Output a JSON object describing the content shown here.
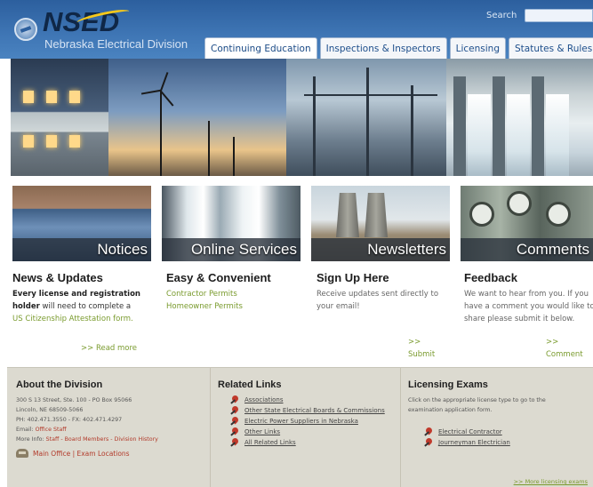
{
  "header": {
    "logo_text": "NSED",
    "subtitle": "Nebraska Electrical Division",
    "search_label": "Search"
  },
  "nav": {
    "tabs": [
      "Continuing Education",
      "Inspections & Inspectors",
      "Licensing",
      "Statutes & Rules"
    ]
  },
  "tiles": {
    "notices": "Notices",
    "online": "Online Services",
    "newsletters": "Newsletters",
    "comments": "Comments"
  },
  "news": {
    "title": "News & Updates",
    "body_bold1": "Every license and registration",
    "body_bold2": "holder",
    "body_rest": " will need to complete a",
    "link": "US Citizenship Attestation form.",
    "more": ">> Read more"
  },
  "easy": {
    "title": "Easy & Convenient",
    "links": [
      "Contractor Permits",
      "Homeowner Permits"
    ]
  },
  "signup": {
    "title": "Sign Up Here",
    "body": "Receive updates sent directly to your email!",
    "more": ">> Submit"
  },
  "feedback": {
    "title": "Feedback",
    "body": "We want to hear from you. If you have a comment you would like to share please submit it below.",
    "more": ">> Comment"
  },
  "footer": {
    "about": {
      "title": "About the Division",
      "address1": "300 S 13 Street, Ste. 100 - PO Box 95066",
      "address2": "Lincoln, NE 68509-5066",
      "phone": "PH: 402.471.3550   -   FX: 402.471.4297",
      "email_label": "Email: ",
      "email_link": "Office Staff",
      "more_label": "More Info: ",
      "more_link": "Staff - Board Members - Division History",
      "office": "Main Office | Exam Locations"
    },
    "related": {
      "title": "Related Links",
      "links": [
        "Associations",
        "Other State Electrical Boards & Commissions",
        "Electric Power Suppliers in Nebraska",
        "Other Links",
        "All Related Links"
      ]
    },
    "exams": {
      "title": "Licensing Exams",
      "body": "Click on the appropriate license type to go to the examination application form.",
      "links": [
        "Electrical Contractor",
        "Journeyman Electrician"
      ],
      "more": ">> More licensing exams"
    }
  },
  "colors": {
    "header_blue": "#3f76b5",
    "link_green": "#7a9b2e",
    "accent_red": "#b23a2a",
    "footer_bg": "#dcdad0"
  }
}
